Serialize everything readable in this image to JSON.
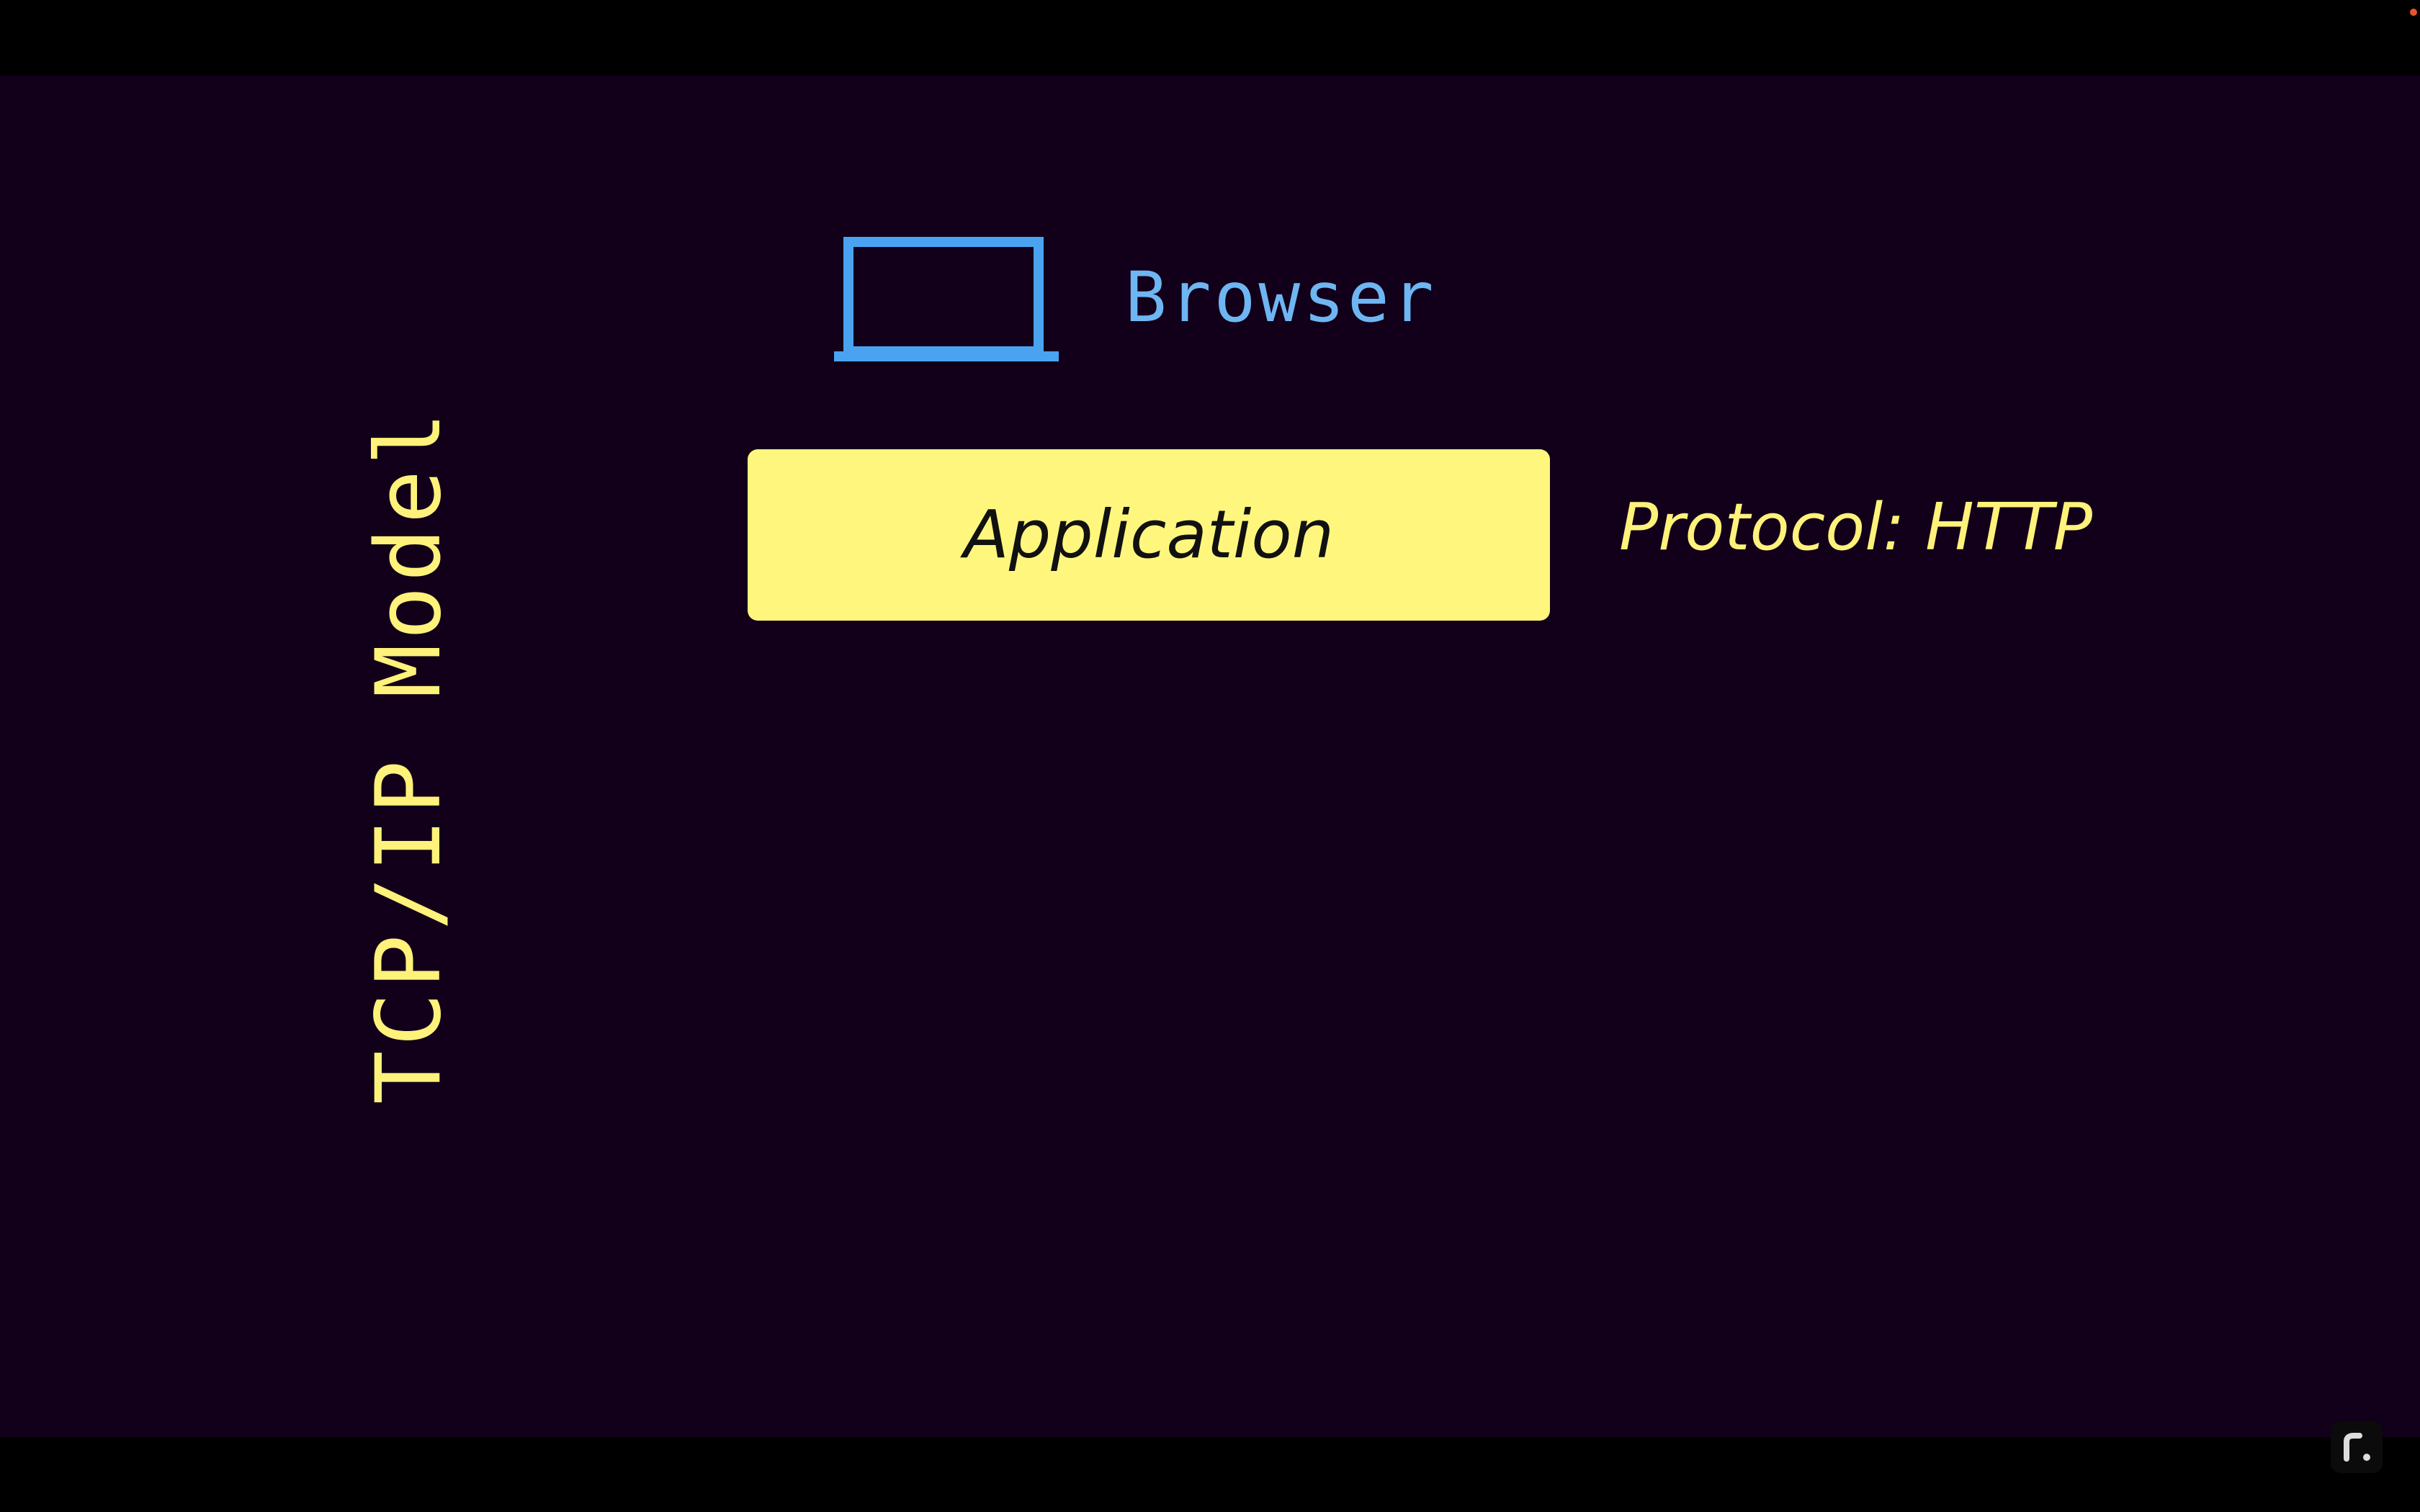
{
  "slide": {
    "title": "TCP/IP Model",
    "browser_label": "Browser",
    "layer_label": "Application",
    "protocol_label": "Protocol: HTTP"
  },
  "icons": {
    "laptop": "laptop-icon",
    "logo": "r-logo-icon"
  },
  "colors": {
    "background": "#12001a",
    "title": "#fff27a",
    "browser": "#4aa3f0",
    "browser_text": "#6eb6f2",
    "layer_box": "#fff77d",
    "layer_text": "#111111"
  }
}
